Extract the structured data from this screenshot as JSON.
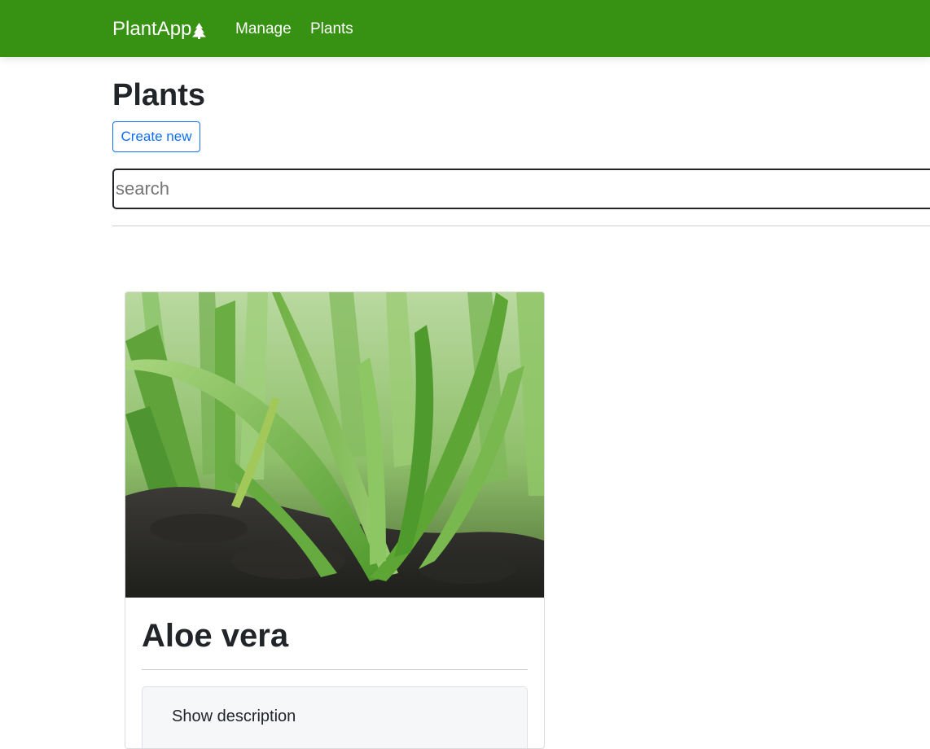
{
  "navbar": {
    "brand": "PlantApp",
    "brand_icon": "tree-icon",
    "links": [
      {
        "label": "Manage"
      },
      {
        "label": "Plants"
      }
    ],
    "background_color": "#379112"
  },
  "page": {
    "title": "Plants",
    "create_button_label": "Create new"
  },
  "search": {
    "placeholder": "search",
    "value": ""
  },
  "plants": [
    {
      "name": "Aloe vera",
      "image": "aloe-vera-photo",
      "description_toggle_label": "Show description"
    }
  ],
  "colors": {
    "accent": "#0d6efd",
    "text": "#212529"
  }
}
